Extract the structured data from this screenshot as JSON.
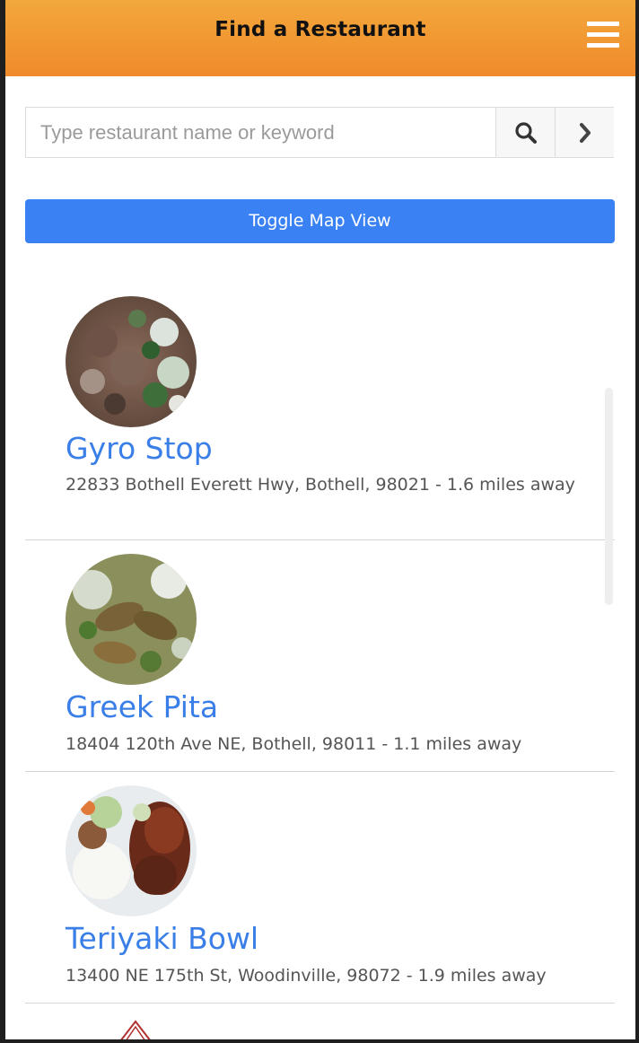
{
  "header": {
    "title": "Find a Restaurant",
    "menu_icon": "hamburger-menu-icon"
  },
  "search": {
    "placeholder": "Type restaurant name or keyword",
    "value": "",
    "search_icon": "search-icon",
    "submit_icon": "chevron-right-icon"
  },
  "toggle_map": {
    "label": "Toggle Map View"
  },
  "restaurants": [
    {
      "name": "Gyro Stop",
      "address": "22833 Bothell Everett Hwy, Bothell, 98021 - 1.6 miles away"
    },
    {
      "name": "Greek Pita",
      "address": "18404 120th Ave NE, Bothell, 98011 - 1.1 miles away"
    },
    {
      "name": "Teriyaki Bowl",
      "address": "13400 NE 175th St, Woodinville, 98072 - 1.9 miles away"
    }
  ],
  "colors": {
    "header_gradient_top": "#f2a83c",
    "header_gradient_bottom": "#f08a2a",
    "accent_blue": "#3a82f4",
    "link_blue": "#3a7ee8"
  }
}
